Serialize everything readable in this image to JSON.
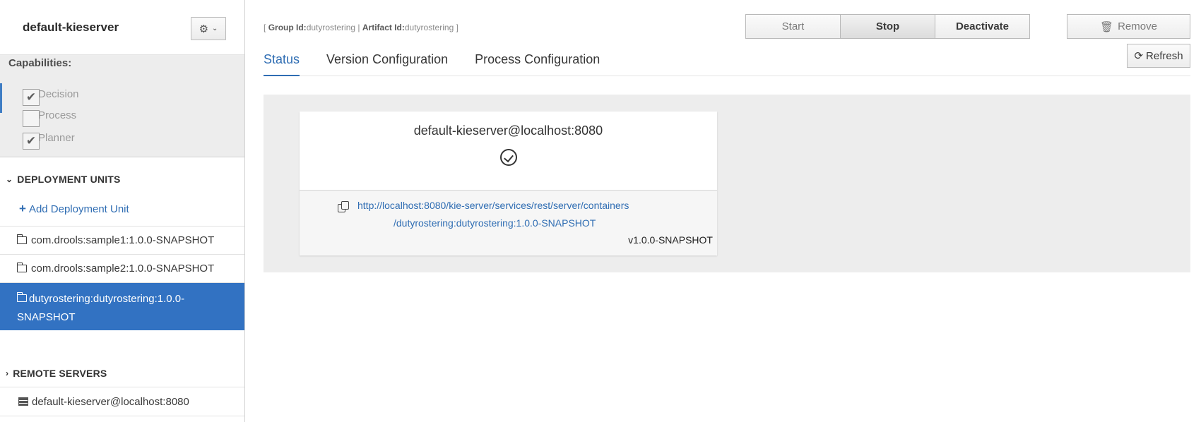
{
  "sidebar": {
    "server_title": "default-kieserver",
    "capabilities_title": "Capabilities:",
    "capabilities": [
      {
        "label": "Decision",
        "checked": true
      },
      {
        "label": "Process",
        "checked": false
      },
      {
        "label": "Planner",
        "checked": true
      }
    ],
    "deployment_units_header": "DEPLOYMENT UNITS",
    "add_unit_label": "Add Deployment Unit",
    "units": [
      {
        "label": "com.drools:sample1:1.0.0-SNAPSHOT"
      },
      {
        "label": "com.drools:sample2:1.0.0-SNAPSHOT"
      },
      {
        "label": "dutyrostering:dutyrostering:1.0.0-SNAPSHOT",
        "selected": true
      }
    ],
    "remote_servers_header": "REMOTE SERVERS",
    "remote_servers": [
      {
        "label": "default-kieserver@localhost:8080"
      }
    ]
  },
  "breadcrumb": {
    "open": "[",
    "group_label": "Group Id:",
    "group_value": "dutyrostering",
    "sep": "|",
    "artifact_label": "Artifact Id:",
    "artifact_value": "dutyrostering",
    "close": "]"
  },
  "toolbar": {
    "start": "Start",
    "stop": "Stop",
    "deactivate": "Deactivate",
    "remove": "Remove",
    "refresh": "Refresh"
  },
  "tabs": [
    "Status",
    "Version Configuration",
    "Process Configuration"
  ],
  "status_card": {
    "title": "default-kieserver@localhost:8080",
    "url_line1": "http://localhost:8080/kie-server/services/rest/server/containers",
    "url_line2": "/dutyrostering:dutyrostering:1.0.0-SNAPSHOT",
    "version": "v1.0.0-SNAPSHOT"
  },
  "colors": {
    "accent": "#2f6db3",
    "selected_row": "#3272c2",
    "panel_bg": "#ededed"
  },
  "icons": [
    "gear-icon",
    "chevron-down-icon",
    "chevron-right-icon",
    "plus-icon",
    "folder-icon",
    "server-icon",
    "trash-icon",
    "refresh-icon",
    "copy-icon",
    "check-circle-icon"
  ]
}
